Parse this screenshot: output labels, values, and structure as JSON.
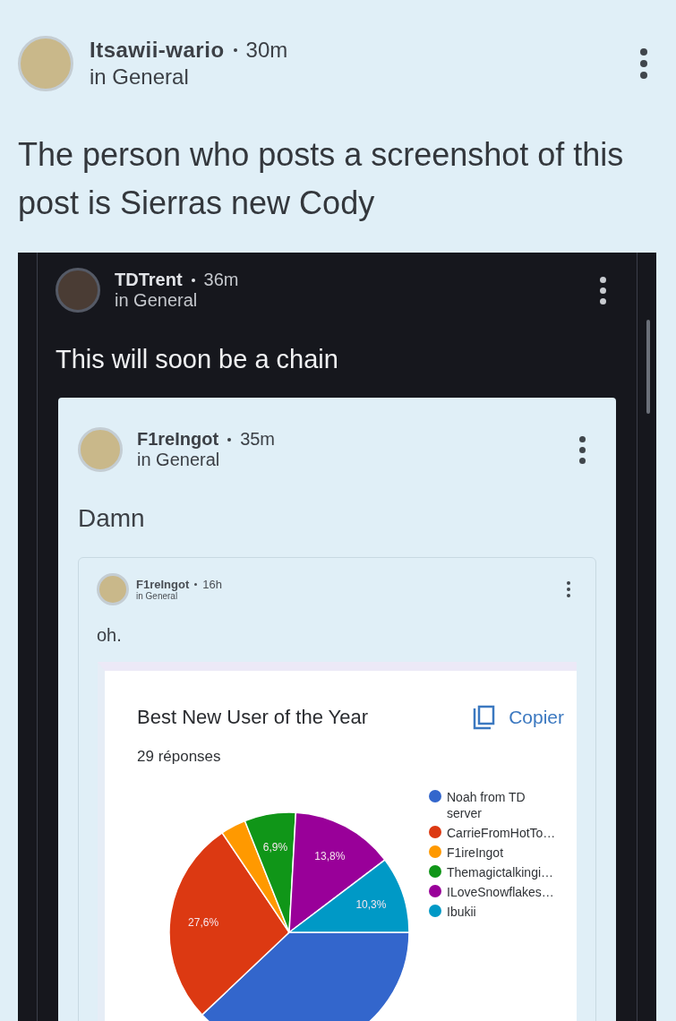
{
  "post": {
    "author": "Itsawii-wario",
    "time": "30m",
    "location": "in General",
    "text": "The person who posts a screenshot of this post is Sierras new Cody",
    "quote": {
      "author": "TDTrent",
      "time": "36m",
      "location": "in General",
      "text": "This will soon be a chain",
      "quote": {
        "author": "F1reIngot",
        "time": "35m",
        "location": "in General",
        "text": "Damn",
        "quote": {
          "author": "F1reIngot",
          "time": "16h",
          "location": "in General",
          "text": "oh.",
          "form_card": {
            "title": "Best New User of the Year",
            "copy_label": "Copier",
            "responses": "29 réponses",
            "chart_data": {
              "type": "pie",
              "categories": [
                "Noah from TD server",
                "CarrieFromHotTo…",
                "F1ireIngot",
                "Themagictalkingi…",
                "ILoveSnowflakes…",
                "Ibukii"
              ],
              "values": [
                37.9,
                27.6,
                3.4,
                6.9,
                13.8,
                10.3
              ],
              "legend": "right",
              "colors": [
                "#3366cc",
                "#dc3912",
                "#ff9900",
                "#109618",
                "#990099",
                "#0099c6"
              ],
              "value_labels": [
                null,
                "27,6%",
                null,
                "6,9%",
                "13,8%",
                "10,3%"
              ]
            }
          }
        }
      }
    }
  }
}
